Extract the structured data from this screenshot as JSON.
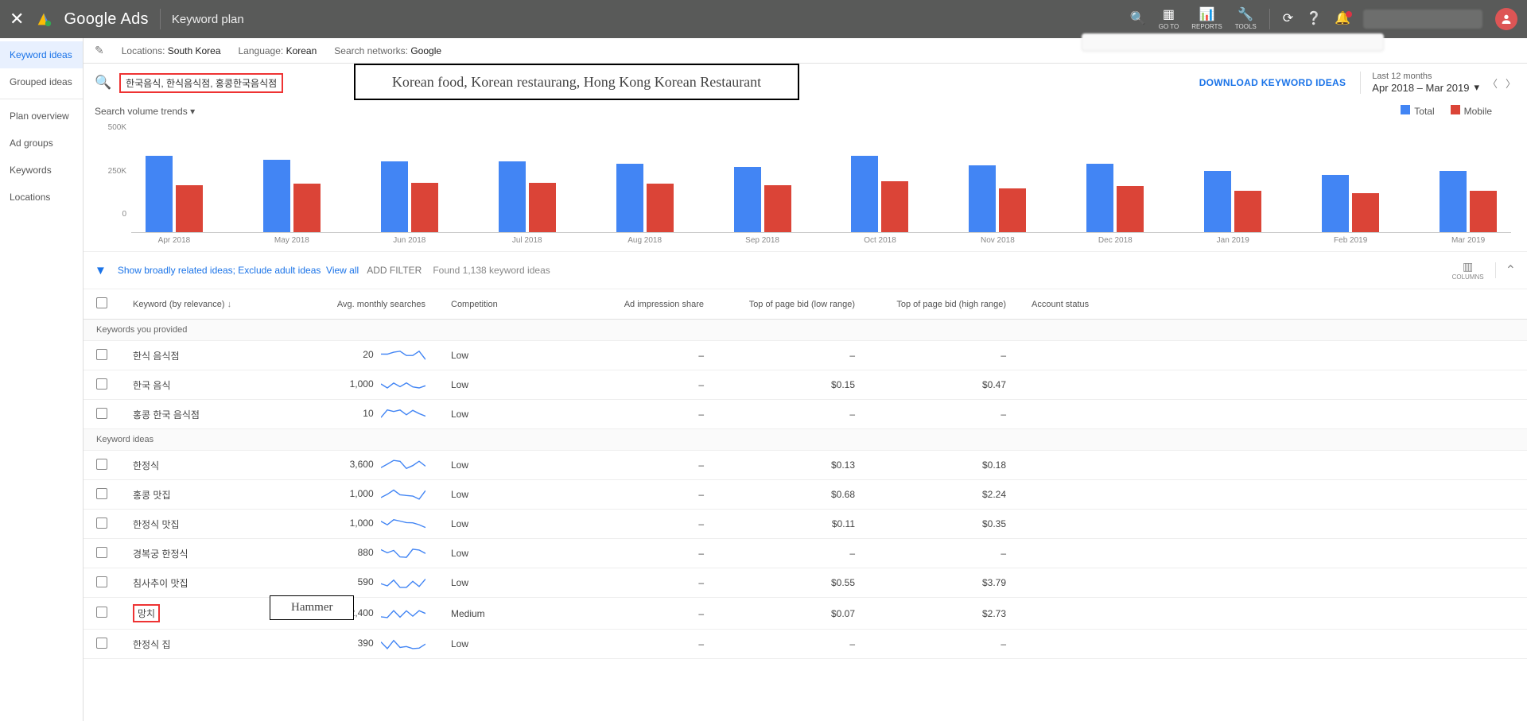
{
  "brand": "Google Ads",
  "page_title": "Keyword plan",
  "topbar_tools": {
    "goto": "GO TO",
    "reports": "REPORTS",
    "tools": "TOOLS"
  },
  "sidebar": {
    "items": [
      {
        "label": "Keyword ideas",
        "active": true
      },
      {
        "label": "Grouped ideas"
      },
      {
        "label": "Plan overview"
      },
      {
        "label": "Ad groups"
      },
      {
        "label": "Keywords"
      },
      {
        "label": "Locations"
      }
    ]
  },
  "subheader": {
    "locations_k": "Locations:",
    "locations_v": "South Korea",
    "language_k": "Language:",
    "language_v": "Korean",
    "networks_k": "Search networks:",
    "networks_v": "Google"
  },
  "search": {
    "chips": "한국음식, 한식음식점, 홍콩한국음식점",
    "annotation": "Korean food, Korean restaurang, Hong Kong Korean Restaurant",
    "download": "DOWNLOAD KEYWORD IDEAS",
    "period_label": "Last 12 months",
    "period_value": "Apr 2018 – Mar 2019"
  },
  "trends_label": "Search volume trends",
  "legend": {
    "total": "Total",
    "mobile": "Mobile"
  },
  "chart_data": {
    "type": "bar",
    "categories": [
      "Apr 2018",
      "May 2018",
      "Jun 2018",
      "Jul 2018",
      "Aug 2018",
      "Sep 2018",
      "Oct 2018",
      "Nov 2018",
      "Dec 2018",
      "Jan 2019",
      "Feb 2019",
      "Mar 2019"
    ],
    "series": [
      {
        "name": "Total",
        "color": "#4285f4",
        "values": [
          400,
          380,
          370,
          370,
          360,
          340,
          400,
          350,
          360,
          320,
          300,
          320
        ]
      },
      {
        "name": "Mobile",
        "color": "#db4437",
        "values": [
          245,
          255,
          260,
          260,
          255,
          245,
          265,
          230,
          240,
          215,
          205,
          215
        ]
      }
    ],
    "ylim": [
      0,
      500
    ],
    "yticks": [
      "500K",
      "250K",
      "0"
    ],
    "ylabel": "",
    "xlabel": "",
    "title": ""
  },
  "filter": {
    "broad": "Show broadly related ideas;",
    "exclude": "Exclude adult ideas",
    "viewall": "View all",
    "add": "ADD FILTER",
    "found": "Found 1,138 keyword ideas",
    "columns": "COLUMNS"
  },
  "columns": {
    "keyword": "Keyword (by relevance)",
    "avg": "Avg. monthly searches",
    "competition": "Competition",
    "impression": "Ad impression share",
    "low_bid": "Top of page bid (low range)",
    "high_bid": "Top of page bid (high range)",
    "status": "Account status"
  },
  "section_provided": "Keywords you provided",
  "section_ideas": "Keyword ideas",
  "rows_provided": [
    {
      "kw": "한식 음식점",
      "avg": "20",
      "comp": "Low",
      "impr": "–",
      "lo": "–",
      "hi": "–"
    },
    {
      "kw": "한국 음식",
      "avg": "1,000",
      "comp": "Low",
      "impr": "–",
      "lo": "$0.15",
      "hi": "$0.47"
    },
    {
      "kw": "홍콩 한국 음식점",
      "avg": "10",
      "comp": "Low",
      "impr": "–",
      "lo": "–",
      "hi": "–"
    }
  ],
  "rows_ideas": [
    {
      "kw": "한정식",
      "avg": "3,600",
      "comp": "Low",
      "impr": "–",
      "lo": "$0.13",
      "hi": "$0.18"
    },
    {
      "kw": "홍콩 맛집",
      "avg": "1,000",
      "comp": "Low",
      "impr": "–",
      "lo": "$0.68",
      "hi": "$2.24"
    },
    {
      "kw": "한정식 맛집",
      "avg": "1,000",
      "comp": "Low",
      "impr": "–",
      "lo": "$0.11",
      "hi": "$0.35"
    },
    {
      "kw": "경복궁 한정식",
      "avg": "880",
      "comp": "Low",
      "impr": "–",
      "lo": "–",
      "hi": "–"
    },
    {
      "kw": "침사추이 맛집",
      "avg": "590",
      "comp": "Low",
      "impr": "–",
      "lo": "$0.55",
      "hi": "$3.79"
    },
    {
      "kw": "망치",
      "avg": "2,400",
      "comp": "Medium",
      "impr": "–",
      "lo": "$0.07",
      "hi": "$2.73",
      "highlight": true,
      "annot": "Hammer"
    },
    {
      "kw": "한정식 집",
      "avg": "390",
      "comp": "Low",
      "impr": "–",
      "lo": "–",
      "hi": "–"
    }
  ]
}
